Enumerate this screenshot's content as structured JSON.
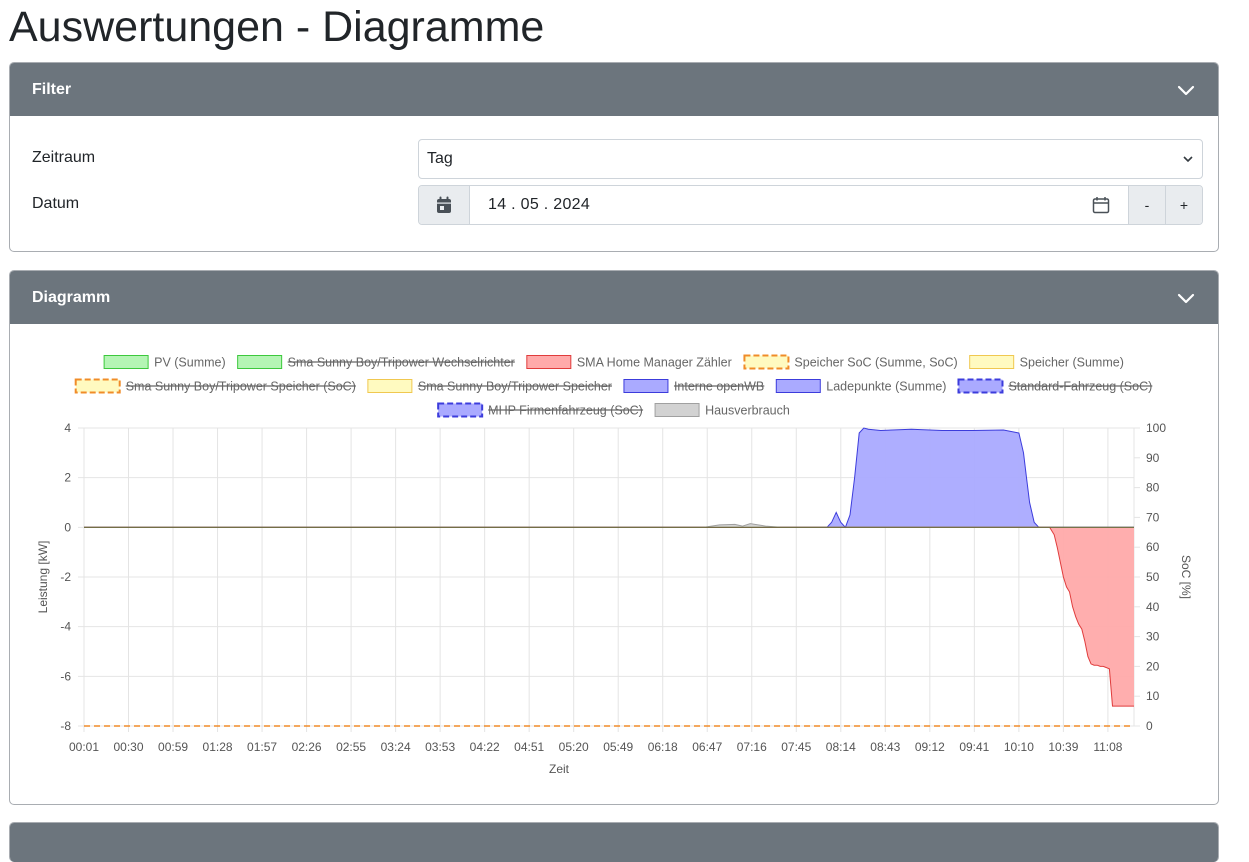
{
  "page": {
    "title": "Auswertungen - Diagramme"
  },
  "filter": {
    "header": "Filter",
    "zeitraum_label": "Zeitraum",
    "zeitraum_value": "Tag",
    "datum_label": "Datum",
    "datum_value": "14 . 05 . 2024",
    "minus": "-",
    "plus": "+"
  },
  "diagram": {
    "header": "Diagramm"
  },
  "chart_data": {
    "type": "area",
    "xlabel": "Zeit",
    "ylabel_left": "Leistung [kW]",
    "ylabel_right": "SoC [%]",
    "ylim_left": [
      -8,
      4
    ],
    "ylim_right": [
      0,
      100
    ],
    "yticks_left": [
      "4",
      "2",
      "0",
      "-2",
      "-4",
      "-6",
      "-8"
    ],
    "yticks_right": [
      "100",
      "90",
      "80",
      "70",
      "60",
      "50",
      "40",
      "30",
      "20",
      "10",
      "0"
    ],
    "xticks": [
      "00:01",
      "00:30",
      "00:59",
      "01:28",
      "01:57",
      "02:26",
      "02:55",
      "03:24",
      "03:53",
      "04:22",
      "04:51",
      "05:20",
      "05:49",
      "06:18",
      "06:47",
      "07:16",
      "07:45",
      "08:14",
      "08:43",
      "09:12",
      "09:41",
      "10:10",
      "10:39",
      "11:08"
    ],
    "x_range": [
      "00:01",
      "11:25"
    ],
    "grid": true,
    "legend_position": "top",
    "legend": [
      {
        "label": "PV (Summe)",
        "fill": "#b4f5b4",
        "stroke": "#3cc83c",
        "dashed": false,
        "hidden": false
      },
      {
        "label": "Sma Sunny Boy/Tripower Wechselrichter",
        "fill": "#b4f5b4",
        "stroke": "#3cc83c",
        "dashed": false,
        "hidden": true
      },
      {
        "label": "SMA Home Manager Zähler",
        "fill": "#ffaaaa",
        "stroke": "#e03c3c",
        "dashed": false,
        "hidden": false
      },
      {
        "label": "Speicher SoC (Summe, SoC)",
        "fill": "#fffac0",
        "stroke": "#f08c28",
        "dashed": true,
        "hidden": false
      },
      {
        "label": "Speicher (Summe)",
        "fill": "#fffac0",
        "stroke": "#f0c850",
        "dashed": false,
        "hidden": false
      },
      {
        "label": "Sma Sunny Boy/Tripower Speicher (SoC)",
        "fill": "#fffac0",
        "stroke": "#f08c28",
        "dashed": true,
        "hidden": true
      },
      {
        "label": "Sma Sunny Boy/Tripower Speicher",
        "fill": "#fffac0",
        "stroke": "#f0c850",
        "dashed": false,
        "hidden": true
      },
      {
        "label": "Interne openWB",
        "fill": "#aaaaff",
        "stroke": "#3c3cdc",
        "dashed": false,
        "hidden": true
      },
      {
        "label": "Ladepunkte (Summe)",
        "fill": "#aaaaff",
        "stroke": "#3c3cdc",
        "dashed": false,
        "hidden": false
      },
      {
        "label": "Standard-Fahrzeug (SoC)",
        "fill": "#aaaaff",
        "stroke": "#3c3cdc",
        "dashed": true,
        "hidden": true
      },
      {
        "label": "MHP Firmenfahrzeug (SoC)",
        "fill": "#aaaaff",
        "stroke": "#3c3cdc",
        "dashed": true,
        "hidden": true
      },
      {
        "label": "Hausverbrauch",
        "fill": "#d2d2d2",
        "stroke": "#a0a0a0",
        "dashed": false,
        "hidden": false
      }
    ],
    "series": [
      {
        "name": "Ladepunkte (Summe)",
        "unit": "kW",
        "x": [
          "00:01",
          "08:05",
          "08:08",
          "08:11",
          "08:14",
          "08:17",
          "08:20",
          "08:23",
          "08:26",
          "08:29",
          "08:32",
          "08:40",
          "09:00",
          "09:20",
          "09:40",
          "10:00",
          "10:10",
          "10:13",
          "10:15",
          "10:17",
          "10:20",
          "10:23",
          "10:26",
          "11:25"
        ],
        "values": [
          0,
          0,
          0.2,
          0.6,
          0.2,
          0,
          0.5,
          2.0,
          3.8,
          4.0,
          3.95,
          3.9,
          3.95,
          3.9,
          3.9,
          3.92,
          3.8,
          3.0,
          2.0,
          1.0,
          0.2,
          0,
          0,
          0
        ]
      },
      {
        "name": "SMA Home Manager Zähler",
        "unit": "kW",
        "x": [
          "00:01",
          "10:30",
          "10:33",
          "10:35",
          "10:37",
          "10:39",
          "10:41",
          "10:43",
          "10:45",
          "10:47",
          "10:49",
          "10:51",
          "10:53",
          "10:55",
          "10:57",
          "10:59",
          "11:01",
          "11:03",
          "11:05",
          "11:07",
          "11:09",
          "11:11",
          "11:13",
          "11:15",
          "11:17",
          "11:19",
          "11:21",
          "11:23",
          "11:25"
        ],
        "values": [
          0,
          0,
          -0.3,
          -0.8,
          -1.4,
          -2.0,
          -2.4,
          -2.6,
          -3.2,
          -3.6,
          -3.9,
          -4.1,
          -4.6,
          -5.2,
          -5.5,
          -5.55,
          -5.55,
          -5.6,
          -5.6,
          -5.65,
          -5.7,
          -7.2,
          -7.2,
          -7.2,
          -7.2,
          -7.2,
          -7.2,
          -7.2,
          -7.2
        ]
      },
      {
        "name": "Hausverbrauch",
        "unit": "kW",
        "x": [
          "00:01",
          "06:45",
          "06:55",
          "07:05",
          "07:10",
          "07:15",
          "07:25",
          "07:35",
          "11:25"
        ],
        "values": [
          0,
          0,
          0.1,
          0.12,
          0.05,
          0.15,
          0.05,
          0,
          0
        ]
      },
      {
        "name": "Speicher SoC (Summe, SoC)",
        "unit": "%",
        "x": [
          "00:01",
          "11:25"
        ],
        "values": [
          0,
          0
        ]
      }
    ]
  }
}
